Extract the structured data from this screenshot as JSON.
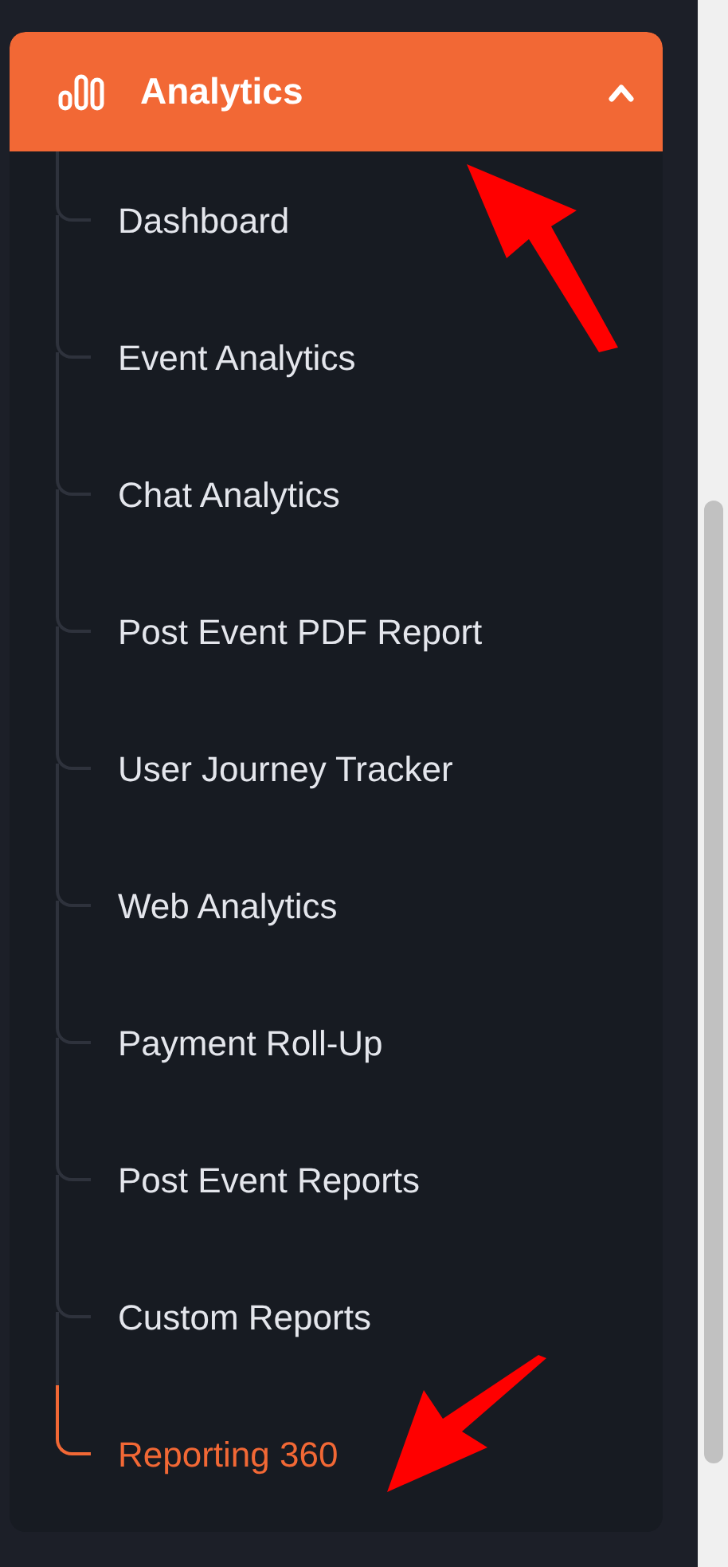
{
  "menu": {
    "title": "Analytics",
    "expanded": true,
    "items": [
      {
        "label": "Dashboard",
        "selected": false
      },
      {
        "label": "Event Analytics",
        "selected": false
      },
      {
        "label": "Chat Analytics",
        "selected": false
      },
      {
        "label": "Post Event PDF Report",
        "selected": false
      },
      {
        "label": "User Journey Tracker",
        "selected": false
      },
      {
        "label": "Web Analytics",
        "selected": false
      },
      {
        "label": "Payment Roll-Up",
        "selected": false
      },
      {
        "label": "Post Event Reports",
        "selected": false
      },
      {
        "label": "Custom Reports",
        "selected": false
      },
      {
        "label": "Reporting 360",
        "selected": true
      }
    ]
  }
}
